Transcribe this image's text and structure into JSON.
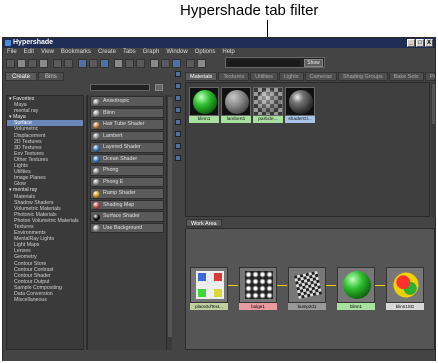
{
  "annotation": {
    "text": "Hypershade tab filter"
  },
  "window": {
    "title": "Hypershade",
    "buttons": [
      "_",
      "□",
      "X"
    ]
  },
  "menu": [
    "File",
    "Edit",
    "View",
    "Bookmarks",
    "Create",
    "Tabs",
    "Graph",
    "Window",
    "Options",
    "Help"
  ],
  "filter": {
    "value": "",
    "show_label": "Show"
  },
  "left_panel": {
    "tabs": [
      "Create",
      "Bins"
    ],
    "tree": [
      {
        "label": "▾ Favorites",
        "level": "h"
      },
      {
        "label": "Maya",
        "level": "i"
      },
      {
        "label": "mental ray",
        "level": "i"
      },
      {
        "label": "▾ Maya",
        "level": "h"
      },
      {
        "label": "Surface",
        "level": "sel"
      },
      {
        "label": "Volumetric",
        "level": "i"
      },
      {
        "label": "Displacement",
        "level": "i"
      },
      {
        "label": "2D Textures",
        "level": "i"
      },
      {
        "label": "3D Textures",
        "level": "i"
      },
      {
        "label": "Env Textures",
        "level": "i"
      },
      {
        "label": "Other Textures",
        "level": "i"
      },
      {
        "label": "Lights",
        "level": "i"
      },
      {
        "label": "Utilities",
        "level": "i"
      },
      {
        "label": "Image Planes",
        "level": "i"
      },
      {
        "label": "Glow",
        "level": "i"
      },
      {
        "label": "▾ mental ray",
        "level": "h"
      },
      {
        "label": "Materials",
        "level": "i"
      },
      {
        "label": "Shadow Shaders",
        "level": "i"
      },
      {
        "label": "Volumetric Materials",
        "level": "i"
      },
      {
        "label": "Photonic Materials",
        "level": "i"
      },
      {
        "label": "Photon Volumetric Materials",
        "level": "i"
      },
      {
        "label": "Textures",
        "level": "i"
      },
      {
        "label": "Environments",
        "level": "i"
      },
      {
        "label": "MentalRay Lights",
        "level": "i"
      },
      {
        "label": "Light Maps",
        "level": "i"
      },
      {
        "label": "Lenses",
        "level": "i"
      },
      {
        "label": "Geometry",
        "level": "i"
      },
      {
        "label": "Contour Store",
        "level": "i"
      },
      {
        "label": "Contour Contrast",
        "level": "i"
      },
      {
        "label": "Contour Shader",
        "level": "i"
      },
      {
        "label": "Contour Output",
        "level": "i"
      },
      {
        "label": "Sample Compositing",
        "level": "i"
      },
      {
        "label": "Data Conversion",
        "level": "i"
      },
      {
        "label": "Miscellaneous",
        "level": "i"
      }
    ],
    "shaders": [
      {
        "label": "Anisotropic",
        "color": "#8a8a8a"
      },
      {
        "label": "Blinn",
        "color": "#9a9a9a"
      },
      {
        "label": "Hair Tube Shader",
        "color": "#c08040"
      },
      {
        "label": "Lambert",
        "color": "#8a8a8a"
      },
      {
        "label": "Layered Shader",
        "color": "#3a78c0"
      },
      {
        "label": "Ocean Shader",
        "color": "#3a78c0"
      },
      {
        "label": "Phong",
        "color": "#8a8a8a"
      },
      {
        "label": "Phong E",
        "color": "#8a8a8a"
      },
      {
        "label": "Ramp Shader",
        "color": "#d0a020"
      },
      {
        "label": "Shading Map",
        "color": "#c05050"
      },
      {
        "label": "Surface Shader",
        "color": "#111111"
      },
      {
        "label": "Use Background",
        "color": "#9a9a9a"
      }
    ]
  },
  "right_tabs": [
    "Materials",
    "Textures",
    "Utilities",
    "Lights",
    "Cameras",
    "Shading Groups",
    "Bake Sets",
    "Projects"
  ],
  "swatches": [
    {
      "label": "blinn1",
      "kind": "green"
    },
    {
      "label": "lambert1",
      "kind": "gray"
    },
    {
      "label": "particle...",
      "kind": "checker"
    },
    {
      "label": "shaderGl...",
      "kind": "dark"
    }
  ],
  "work_area": {
    "tab": "Work Area",
    "nodes": [
      {
        "label": "place2dText...",
        "kind": "place2d"
      },
      {
        "label": "bulge1",
        "kind": "bulge"
      },
      {
        "label": "bump2d1",
        "kind": "bump"
      },
      {
        "label": "blinn1",
        "kind": "blinn"
      },
      {
        "label": "blinn1SG",
        "kind": "sg"
      }
    ]
  }
}
